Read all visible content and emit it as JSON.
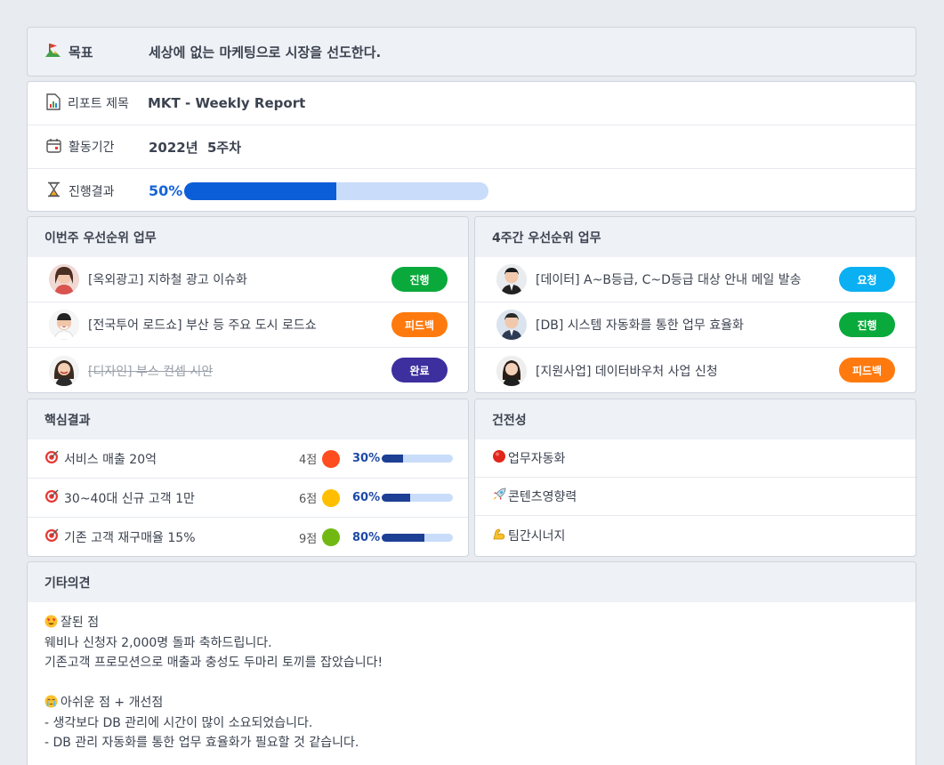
{
  "goal": {
    "label": "목표",
    "text": "세상에 없는 마케팅으로 시장을 선도한다."
  },
  "report": {
    "title_label": "리포트 제목",
    "title_value": "MKT - Weekly Report",
    "period_label": "활동기간",
    "period_value": "2022년  5주차",
    "progress_label": "진행결과",
    "progress_text": "50%",
    "progress_value": 0.5
  },
  "this_week": {
    "title": "이번주 우선순위 업무",
    "tasks": [
      {
        "text": "[옥외광고] 지하철 광고 이슈화",
        "status": "진행",
        "status_color": "#0aa93c",
        "done": false
      },
      {
        "text": "[전국투어 로드쇼] 부산 등 주요 도시 로드쇼",
        "status": "피드백",
        "status_color": "#ff7a0e",
        "done": false
      },
      {
        "text": "[디자인] 부스 컨셉 시안",
        "status": "완료",
        "status_color": "#3d2f9e",
        "done": true
      }
    ]
  },
  "four_week": {
    "title": "4주간 우선순위 업무",
    "tasks": [
      {
        "text": "[데이터] A~B등급, C~D등급 대상 안내 메일 발송",
        "status": "요청",
        "status_color": "#0ab0f2",
        "done": false
      },
      {
        "text": "[DB] 시스템 자동화를 통한 업무 효율화",
        "status": "진행",
        "status_color": "#0aa93c",
        "done": false
      },
      {
        "text": "[지원사업] 데이터바우처 사업 신청",
        "status": "피드백",
        "status_color": "#ff7a0e",
        "done": false
      }
    ]
  },
  "key_results": {
    "title": "핵심결과",
    "items": [
      {
        "text": "서비스 매출 20억",
        "score": "4점",
        "dot_color": "#ff4d1f",
        "pct": "30%",
        "value": 0.3
      },
      {
        "text": "30~40대 신규 고객 1만",
        "score": "6점",
        "dot_color": "#ffbf00",
        "pct": "60%",
        "value": 0.4
      },
      {
        "text": "기존 고객 재구매율 15%",
        "score": "9점",
        "dot_color": "#71b912",
        "pct": "80%",
        "value": 0.6
      }
    ]
  },
  "health": {
    "title": "건전성",
    "items": [
      {
        "icon": "red-circle-icon",
        "text": "업무자동화"
      },
      {
        "icon": "rocket-icon",
        "text": "콘텐츠영향력"
      },
      {
        "icon": "flexed-arm-icon",
        "text": "팀간시너지"
      }
    ]
  },
  "other": {
    "title": "기타의견",
    "lines": [
      "잘된 점",
      "웨비나 신청자 2,000명 돌파 축하드립니다.",
      "기존고객 프로모션으로 매출과 충성도 두마리 토끼를 잡았습니다!",
      "",
      "아쉬운 점 + 개선점",
      "- 생각보다 DB 관리에 시간이 많이 소요되었습니다.",
      "- DB 관리 자동화를 통한 업무 효율화가 필요할 것 같습니다."
    ]
  }
}
